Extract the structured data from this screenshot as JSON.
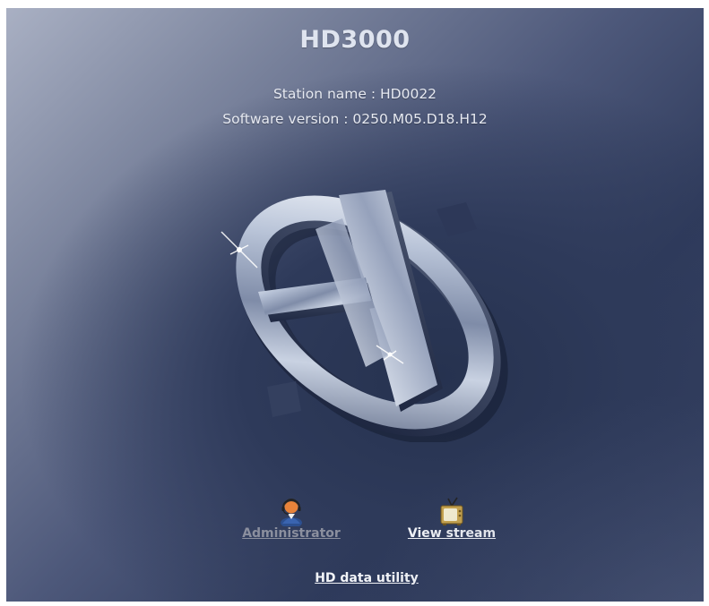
{
  "header": {
    "title": "HD3000",
    "station_name": "Station name : HD0022",
    "software_version": "Software version : 0250.M05.D18.H12"
  },
  "logo": {
    "icon": "hd-chrome-logo"
  },
  "actions": {
    "administrator": {
      "label": "Administrator",
      "icon": "administrator-icon",
      "enabled": false
    },
    "view_stream": {
      "label": "View stream",
      "icon": "tv-icon",
      "enabled": true
    },
    "data_utility": {
      "label": "HD data utility"
    }
  },
  "colors": {
    "background_dark": "#2e3a5a",
    "background_light": "#a9b0c3",
    "text": "#e6e9f1",
    "link": "#f2f4f8",
    "link_disabled": "#8b8f9e"
  }
}
